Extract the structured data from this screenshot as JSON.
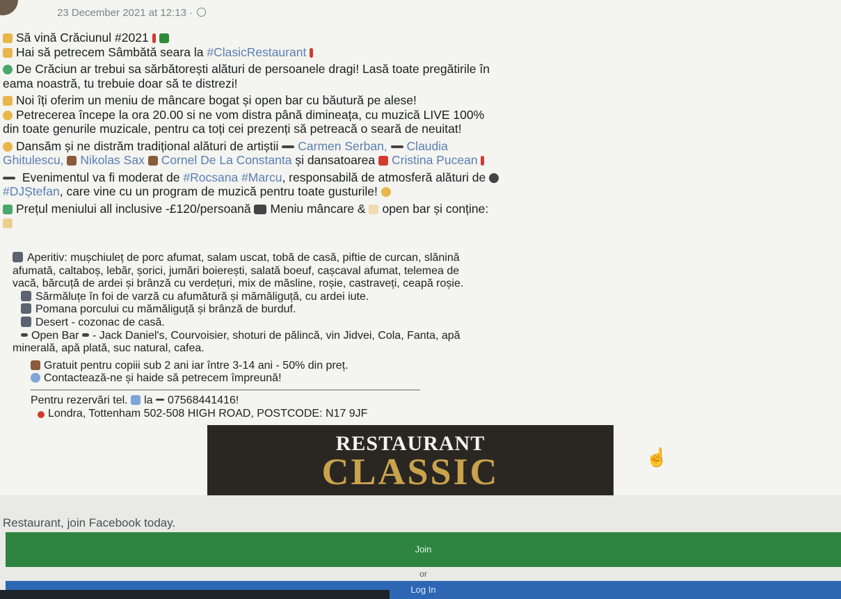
{
  "post": {
    "timestamp": "23 December 2021 at 12:13 ·",
    "lines": [
      "Să vină Crăciunul #2021",
      "Hai să petrecem Sâmbătă seara la",
      "#ClasicRestaurant",
      "De Crăciun ar trebui sa sărbătorești alături de persoanele dragi! Lasă toate pregătirile în",
      "eama noastră, tu trebuie doar să te distrezi!",
      "Noi îți oferim un meniu de mâncare bogat și open bar cu băutură pe alese!",
      "Petrecerea începe la ora 20.00 si ne vom distra până dimineața, cu muzică LIVE 100%",
      "din toate genurile muzicale, pentru ca toți cei prezenți să petreacă o seară de neuitat!",
      "Dansăm și ne distrăm tradițional alături de artiștii",
      "Carmen Serban,",
      "Claudia",
      "Ghitulescu,",
      "Nikolas Sax",
      "Cornel De La Constanta",
      "și dansatoarea",
      "Cristina Pucean",
      "Evenimentul va fi moderat de",
      "#Rocsana #Marcu",
      ", responsabilă de atmosferă alături de",
      "#DJȘtefan",
      ", care vine cu un program de muzică pentru toate gusturile!",
      "Prețul meniului all inclusive -£120/persoană",
      "Meniu mâncare &",
      "open bar și conține:"
    ],
    "menu": [
      "Aperitiv: mușchiuleț de porc afumat, salam uscat, tobă de casă, piftie de curcan, slănină",
      "afumată, caltaboș, lebăr, șorici, jumări boierești, salată boeuf, cașcaval afumat, telemea de",
      "vacă, bărcuță de ardei și brânză cu verdețuri, mix de măsline, roșie, castraveți, ceapă roșie.",
      "Sărmăluțe în foi de varză cu afumătură și mămăliguță, cu ardei iute.",
      "Pomana porcului cu mămăliguță și brânză de burduf.",
      "Desert - cozonac de casă.",
      "Open Bar",
      "- Jack Daniel's, Courvoisier, shoturi de pălincă, vin Jidvei, Cola, Fanta, apă",
      "minerală, apă plată, suc natural, cafea.",
      "Gratuit pentru copiii sub 2 ani iar între 3-14 ani - 50% din preț.",
      "Contactează-ne și haide să petrecem împreună!",
      "Pentru rezervări tel.",
      "la",
      "07568441416!",
      "Londra, Tottenham 502-508 HIGH ROAD, POSTCODE: N17 9JF"
    ],
    "banner": {
      "line1": "RESTAURANT",
      "line2": "CLASSIC"
    }
  },
  "cta": {
    "text": "Restaurant, join Facebook today.",
    "join": "Join",
    "or": "or",
    "login": "Log In"
  }
}
